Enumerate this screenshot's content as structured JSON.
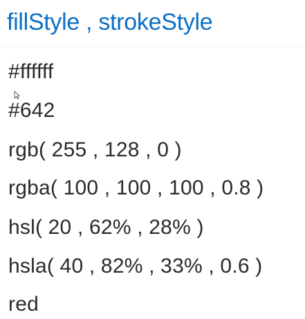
{
  "slide": {
    "title": "fillStyle , strokeStyle",
    "items": [
      "#ffffff",
      "#642",
      "rgb( 255 , 128 , 0 )",
      "rgba( 100 , 100 , 100 , 0.8 )",
      "hsl( 20 , 62% , 28% )",
      "hsla( 40 , 82% , 33% , 0.6 )",
      "red"
    ]
  },
  "colors": {
    "title": "#0b6fc4",
    "body_text": "#2a2a2a",
    "background": "#ffffff"
  },
  "icons": {
    "cursor": "mouse-pointer-icon"
  }
}
